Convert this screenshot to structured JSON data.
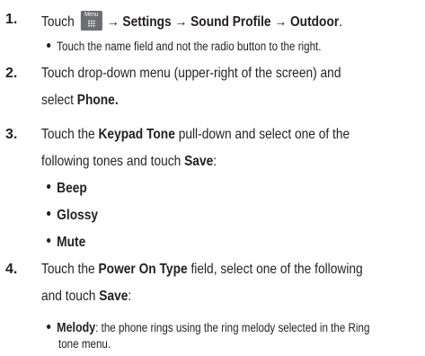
{
  "steps": [
    {
      "number": "1.",
      "prefix": "Touch",
      "icon_label": "Menu",
      "path": "→ Settings → Sound Profile → Outdoor",
      "end": ".",
      "note": "Touch the name field and not the radio button to the right."
    },
    {
      "number": "2.",
      "line1": "Touch drop-down menu (upper-right of the screen) and",
      "line2_prefix": "select ",
      "line2_bold": "Phone."
    },
    {
      "number": "3.",
      "line1_a": "Touch the ",
      "line1_b": "Keypad Tone",
      "line1_c": " pull-down and select one of the",
      "line2_a": "following tones and touch ",
      "line2_b": "Save",
      "line2_c": ":",
      "options": [
        "Beep",
        "Glossy",
        "Mute"
      ]
    },
    {
      "number": "4.",
      "line1_a": "Touch the ",
      "line1_b": "Power On Type",
      "line1_c": " field, select one of the following",
      "line2_a": "and touch ",
      "line2_b": "Save",
      "line2_c": ":",
      "melody_term": "Melody",
      "melody_desc1": ": the phone rings using the ring melody selected in the Ring",
      "melody_desc2": "tone menu."
    }
  ]
}
